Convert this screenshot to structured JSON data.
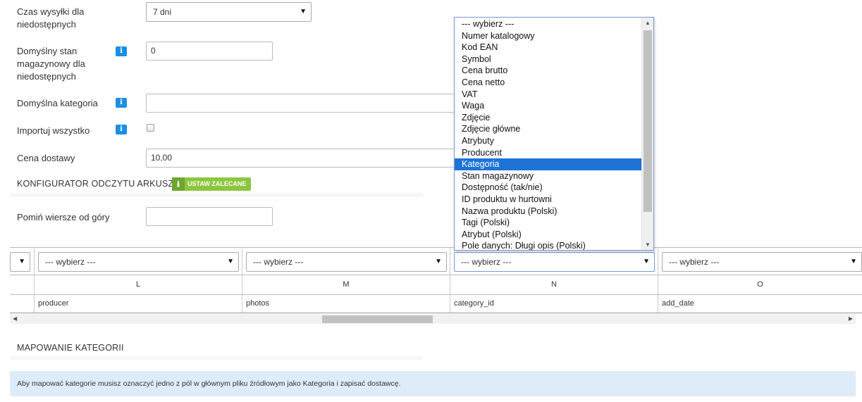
{
  "form": {
    "shipping_unavailable": {
      "label": "Czas wysyłki dla niedostępnych",
      "value": "7 dni"
    },
    "default_stock": {
      "label": "Domyślny stan magazynowy dla niedostępnych",
      "value": "0"
    },
    "default_category": {
      "label": "Domyślna kategoria",
      "value": ""
    },
    "import_all": {
      "label": "Importuj wszystko",
      "checked": false
    },
    "delivery_price": {
      "label": "Cena dostawy",
      "value": "10,00"
    },
    "info_icon": "i"
  },
  "sheet_config": {
    "title": "KONFIGURATOR ODCZYTU ARKUSZA",
    "button_label": "USTAW ZALECANE",
    "button_icon": "download-icon",
    "skip_rows_label": "Pomiń wiersze od góry",
    "skip_rows_value": ""
  },
  "columns": {
    "selects": [
      "",
      "--- wybierz ---",
      "--- wybierz ---",
      "--- wybierz ---",
      "--- wybierz ---"
    ],
    "letters": [
      "",
      "L",
      "M",
      "N",
      "O"
    ],
    "values": [
      "",
      "producer",
      "photos",
      "category_id",
      "add_date"
    ]
  },
  "dropdown": {
    "selected_index": 12,
    "options": [
      "--- wybierz ---",
      "Numer katalogowy",
      "Kod EAN",
      "Symbol",
      "Cena brutto",
      "Cena netto",
      "VAT",
      "Waga",
      "Zdjęcie",
      "Zdjęcie główne",
      "Atrybuty",
      "Producent",
      "Kategoria",
      "Stan magazynowy",
      "Dostępność (tak/nie)",
      "ID produktu w hurtowni",
      "Nazwa produktu (Polski)",
      "Tagi (Polski)",
      "Atrybut (Polski)",
      "Pole danych: Długi opis (Polski)"
    ]
  },
  "category_mapping": {
    "title": "MAPOWANIE KATEGORII",
    "alert": "Aby mapować kategorie musisz oznaczyć jedno z pól w głównym pliku źródłowym jako Kategoria i zapisać dostawcę."
  },
  "colors": {
    "accent_blue": "#1a8fe3",
    "selected_option": "#1e73d6",
    "button_green": "#8cc63f",
    "alert_bg": "#deecf9"
  }
}
